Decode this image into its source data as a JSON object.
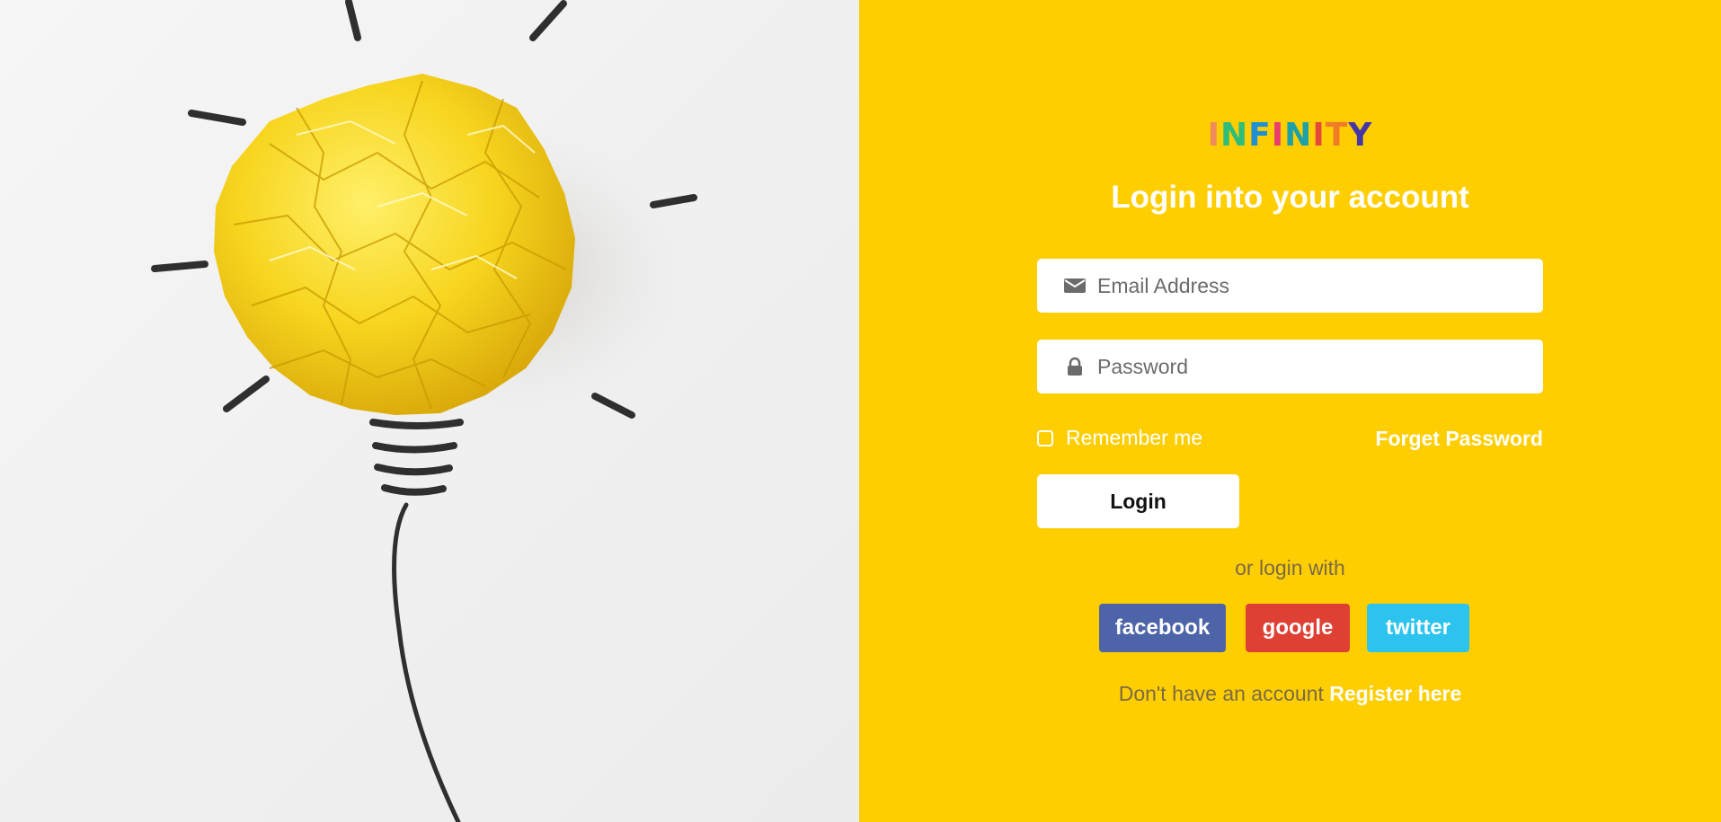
{
  "brand": {
    "logo_letters": [
      {
        "char": "I",
        "color": "#f08a5d"
      },
      {
        "char": "N",
        "color": "#2ebd7a"
      },
      {
        "char": "F",
        "color": "#1f8fd6"
      },
      {
        "char": "I",
        "color": "#e93d6f"
      },
      {
        "char": "N",
        "color": "#1da0a8"
      },
      {
        "char": "I",
        "color": "#e8473c"
      },
      {
        "char": "T",
        "color": "#f27b2a"
      },
      {
        "char": "Y",
        "color": "#4637a8"
      }
    ]
  },
  "login": {
    "title": "Login into your account",
    "email_placeholder": "Email Address",
    "email_icon": "envelope-icon",
    "password_placeholder": "Password",
    "password_icon": "lock-icon",
    "remember_label": "Remember me",
    "forget_label": "Forget Password",
    "login_button": "Login",
    "or_login_with": "or login with"
  },
  "social": [
    {
      "label": "facebook",
      "color": "#4d64a8"
    },
    {
      "label": "google",
      "color": "#de4034"
    },
    {
      "label": "twitter",
      "color": "#2cc4ef"
    }
  ],
  "register": {
    "prompt": "Don't have an account",
    "link": "Register here"
  },
  "colors": {
    "panel_background": "#ffce00",
    "text_white": "#ffffff",
    "muted_text": "#7a6a45"
  },
  "illustration": {
    "subject": "crumpled-paper-lightbulb-icon"
  }
}
